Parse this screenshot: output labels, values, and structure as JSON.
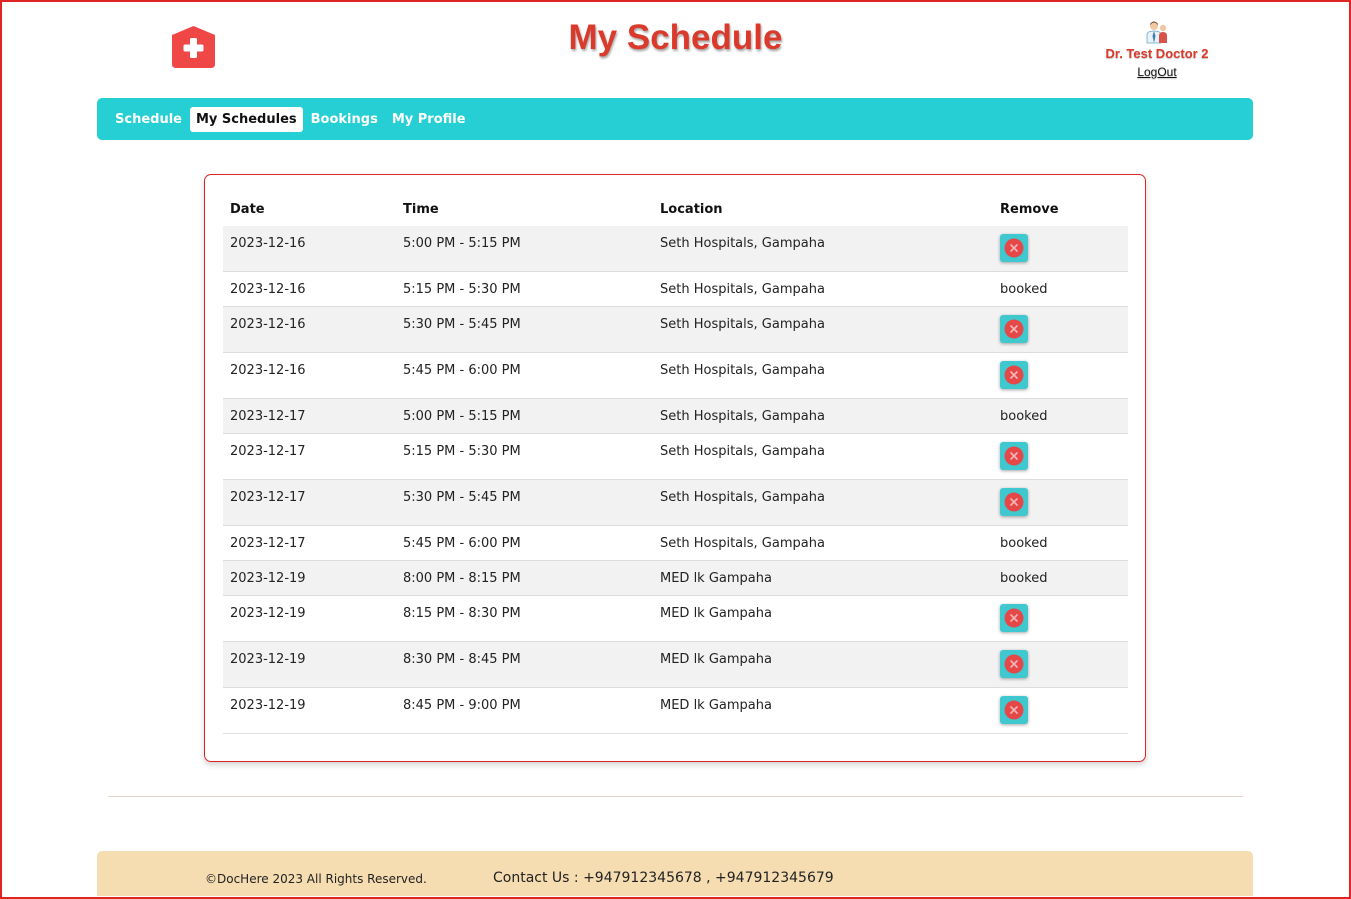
{
  "header": {
    "title": "My Schedule",
    "user_name": "Dr. Test Doctor 2",
    "logout_label": "LogOut",
    "brand_color": "#d93a2b"
  },
  "nav": {
    "items": [
      {
        "label": "Schedule",
        "active": false
      },
      {
        "label": "My Schedules",
        "active": true
      },
      {
        "label": "Bookings",
        "active": false
      },
      {
        "label": "My Profile",
        "active": false
      }
    ],
    "color": "#26cfd3"
  },
  "table": {
    "headers": {
      "date": "Date",
      "time": "Time",
      "location": "Location",
      "remove": "Remove"
    },
    "rows": [
      {
        "date": "2023-12-16",
        "time": "5:00 PM - 5:15 PM",
        "location": "Seth Hospitals, Gampaha",
        "status": "remove"
      },
      {
        "date": "2023-12-16",
        "time": "5:15 PM - 5:30 PM",
        "location": "Seth Hospitals, Gampaha",
        "status": "booked"
      },
      {
        "date": "2023-12-16",
        "time": "5:30 PM - 5:45 PM",
        "location": "Seth Hospitals, Gampaha",
        "status": "remove"
      },
      {
        "date": "2023-12-16",
        "time": "5:45 PM - 6:00 PM",
        "location": "Seth Hospitals, Gampaha",
        "status": "remove"
      },
      {
        "date": "2023-12-17",
        "time": "5:00 PM - 5:15 PM",
        "location": "Seth Hospitals, Gampaha",
        "status": "booked"
      },
      {
        "date": "2023-12-17",
        "time": "5:15 PM - 5:30 PM",
        "location": "Seth Hospitals, Gampaha",
        "status": "remove"
      },
      {
        "date": "2023-12-17",
        "time": "5:30 PM - 5:45 PM",
        "location": "Seth Hospitals, Gampaha",
        "status": "remove"
      },
      {
        "date": "2023-12-17",
        "time": "5:45 PM - 6:00 PM",
        "location": "Seth Hospitals, Gampaha",
        "status": "booked"
      },
      {
        "date": "2023-12-19",
        "time": "8:00 PM - 8:15 PM",
        "location": "MED lk Gampaha",
        "status": "booked"
      },
      {
        "date": "2023-12-19",
        "time": "8:15 PM - 8:30 PM",
        "location": "MED lk Gampaha",
        "status": "remove"
      },
      {
        "date": "2023-12-19",
        "time": "8:30 PM - 8:45 PM",
        "location": "MED lk Gampaha",
        "status": "remove"
      },
      {
        "date": "2023-12-19",
        "time": "8:45 PM - 9:00 PM",
        "location": "MED lk Gampaha",
        "status": "remove"
      }
    ],
    "booked_label": "booked",
    "remove_icon": "close-circle-icon"
  },
  "footer": {
    "copyright": "©DocHere 2023 All Rights Reserved.",
    "contact": "Contact Us : +947912345678 , +947912345679",
    "color": "#f5ddb1"
  }
}
